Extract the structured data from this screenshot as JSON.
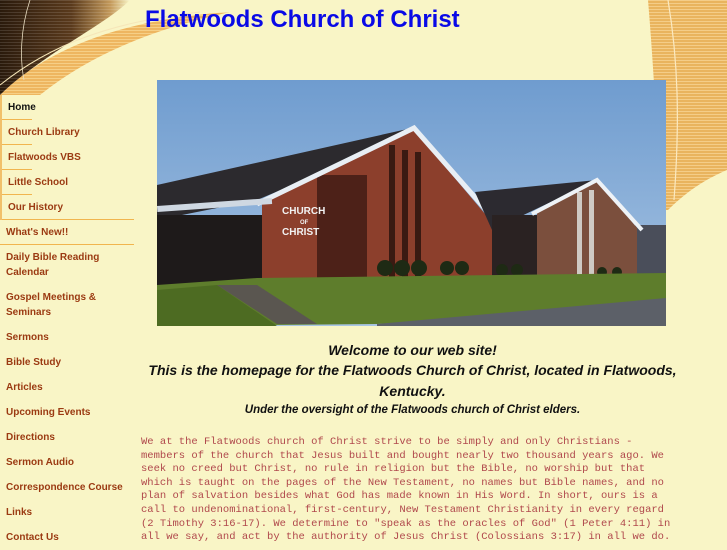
{
  "header": {
    "title": "Flatwoods Church of Christ"
  },
  "sidebar": {
    "items": [
      {
        "label": "Home",
        "active": true
      },
      {
        "label": "Church Library"
      },
      {
        "label": "Flatwoods VBS"
      },
      {
        "label": "Little School"
      },
      {
        "label": "Our History"
      },
      {
        "label": "What's New!!"
      },
      {
        "label": "Daily Bible Reading Calendar"
      },
      {
        "label": "Gospel Meetings & Seminars"
      },
      {
        "label": "Sermons"
      },
      {
        "label": "Bible Study"
      },
      {
        "label": "Articles"
      },
      {
        "label": "Upcoming Events"
      },
      {
        "label": "Directions"
      },
      {
        "label": "Sermon Audio"
      },
      {
        "label": "Correspondence Course"
      },
      {
        "label": "Links"
      },
      {
        "label": "Contact Us"
      }
    ]
  },
  "photo": {
    "alt": "Flatwoods Church of Christ building",
    "sign_line1": "CHURCH",
    "sign_line2": "OF",
    "sign_line3": "CHRIST"
  },
  "welcome": {
    "line1": "Welcome to our web site!",
    "line2": "This is the homepage for the Flatwoods Church of Christ, located in Flatwoods, Kentucky.",
    "line3": "Under the oversight of the Flatwoods church of Christ elders."
  },
  "intro": {
    "text": "We at the Flatwoods church of Christ strive to be simply and only Christians - members of the church that Jesus built and bought nearly two thousand years ago. We seek no creed but Christ, no rule in religion but the Bible, no worship but that which is taught on the pages of the New Testament, no names but Bible names, and no plan of salvation besides what God has made known in His Word. In short, ours is a call to undenominational, first-century, New Testament Christianity in every regard (2 Timothy 3:16-17). We determine to \"speak as the oracles of God\" (1 Peter 4:11) in all we say, and act by the authority of Jesus Christ (Colossians 3:17) in all we do."
  },
  "colors": {
    "background": "#f9f5c6",
    "title": "#0a0ae6",
    "nav_link": "#9b3a12",
    "nav_active": "#111111",
    "intro_text": "#b0484c",
    "accent_stripe": "#f1b54e"
  }
}
